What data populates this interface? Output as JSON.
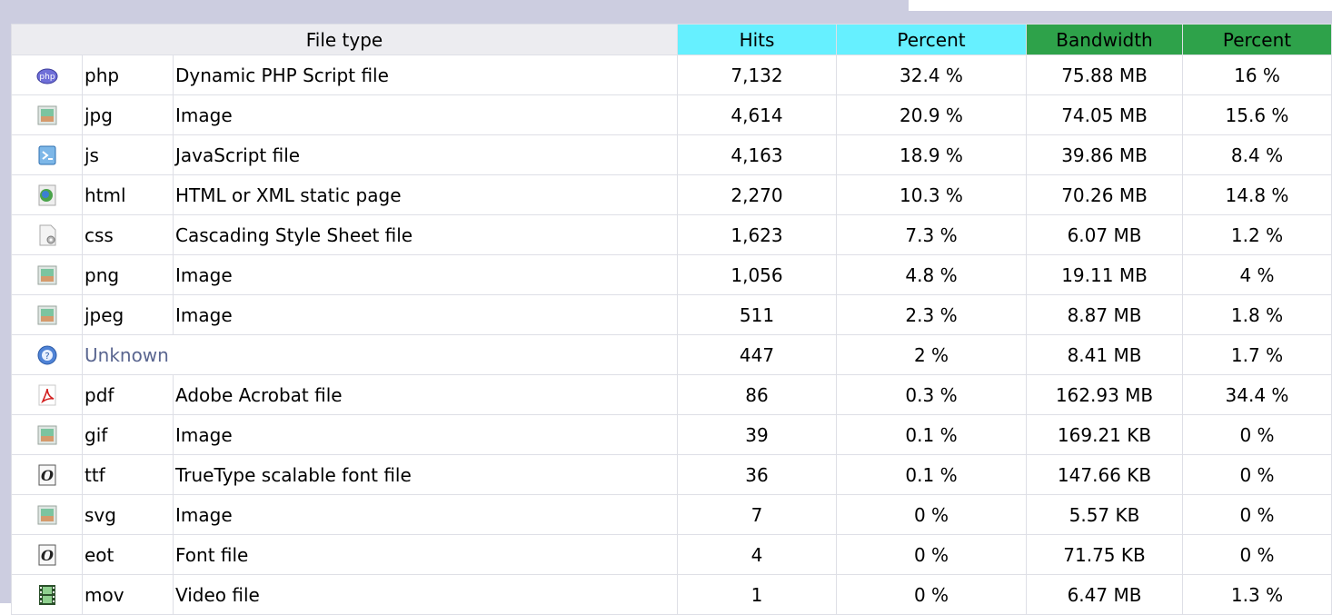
{
  "headers": {
    "file_type": "File type",
    "hits": "Hits",
    "hits_percent": "Percent",
    "bandwidth": "Bandwidth",
    "bandwidth_percent": "Percent"
  },
  "colors": {
    "hits_header": "#66f0ff",
    "bandwidth_header": "#2ea24a",
    "panel": "#cccde0"
  },
  "rows": [
    {
      "icon": "php-icon",
      "ext": "php",
      "desc": "Dynamic PHP Script file",
      "hits": "7,132",
      "hits_pct": "32.4 %",
      "bw": "75.88 MB",
      "bw_pct": "16 %"
    },
    {
      "icon": "image-icon",
      "ext": "jpg",
      "desc": "Image",
      "hits": "4,614",
      "hits_pct": "20.9 %",
      "bw": "74.05 MB",
      "bw_pct": "15.6 %"
    },
    {
      "icon": "javascript-icon",
      "ext": "js",
      "desc": "JavaScript file",
      "hits": "4,163",
      "hits_pct": "18.9 %",
      "bw": "39.86 MB",
      "bw_pct": "8.4 %"
    },
    {
      "icon": "html-globe-icon",
      "ext": "html",
      "desc": "HTML or XML static page",
      "hits": "2,270",
      "hits_pct": "10.3 %",
      "bw": "70.26 MB",
      "bw_pct": "14.8 %"
    },
    {
      "icon": "css-icon",
      "ext": "css",
      "desc": "Cascading Style Sheet file",
      "hits": "1,623",
      "hits_pct": "7.3 %",
      "bw": "6.07 MB",
      "bw_pct": "1.2 %"
    },
    {
      "icon": "image-icon",
      "ext": "png",
      "desc": "Image",
      "hits": "1,056",
      "hits_pct": "4.8 %",
      "bw": "19.11 MB",
      "bw_pct": "4 %"
    },
    {
      "icon": "image-icon",
      "ext": "jpeg",
      "desc": "Image",
      "hits": "511",
      "hits_pct": "2.3 %",
      "bw": "8.87 MB",
      "bw_pct": "1.8 %"
    },
    {
      "icon": "unknown-icon",
      "ext": "Unknown",
      "desc": "",
      "hits": "447",
      "hits_pct": "2 %",
      "bw": "8.41 MB",
      "bw_pct": "1.7 %",
      "unknown": true
    },
    {
      "icon": "pdf-icon",
      "ext": "pdf",
      "desc": "Adobe Acrobat file",
      "hits": "86",
      "hits_pct": "0.3 %",
      "bw": "162.93 MB",
      "bw_pct": "34.4 %"
    },
    {
      "icon": "image-icon",
      "ext": "gif",
      "desc": "Image",
      "hits": "39",
      "hits_pct": "0.1 %",
      "bw": "169.21 KB",
      "bw_pct": "0 %"
    },
    {
      "icon": "font-icon",
      "ext": "ttf",
      "desc": "TrueType scalable font file",
      "hits": "36",
      "hits_pct": "0.1 %",
      "bw": "147.66 KB",
      "bw_pct": "0 %"
    },
    {
      "icon": "image-icon",
      "ext": "svg",
      "desc": "Image",
      "hits": "7",
      "hits_pct": "0 %",
      "bw": "5.57 KB",
      "bw_pct": "0 %"
    },
    {
      "icon": "font-icon",
      "ext": "eot",
      "desc": "Font file",
      "hits": "4",
      "hits_pct": "0 %",
      "bw": "71.75 KB",
      "bw_pct": "0 %"
    },
    {
      "icon": "video-icon",
      "ext": "mov",
      "desc": "Video file",
      "hits": "1",
      "hits_pct": "0 %",
      "bw": "6.47 MB",
      "bw_pct": "1.3 %"
    }
  ]
}
